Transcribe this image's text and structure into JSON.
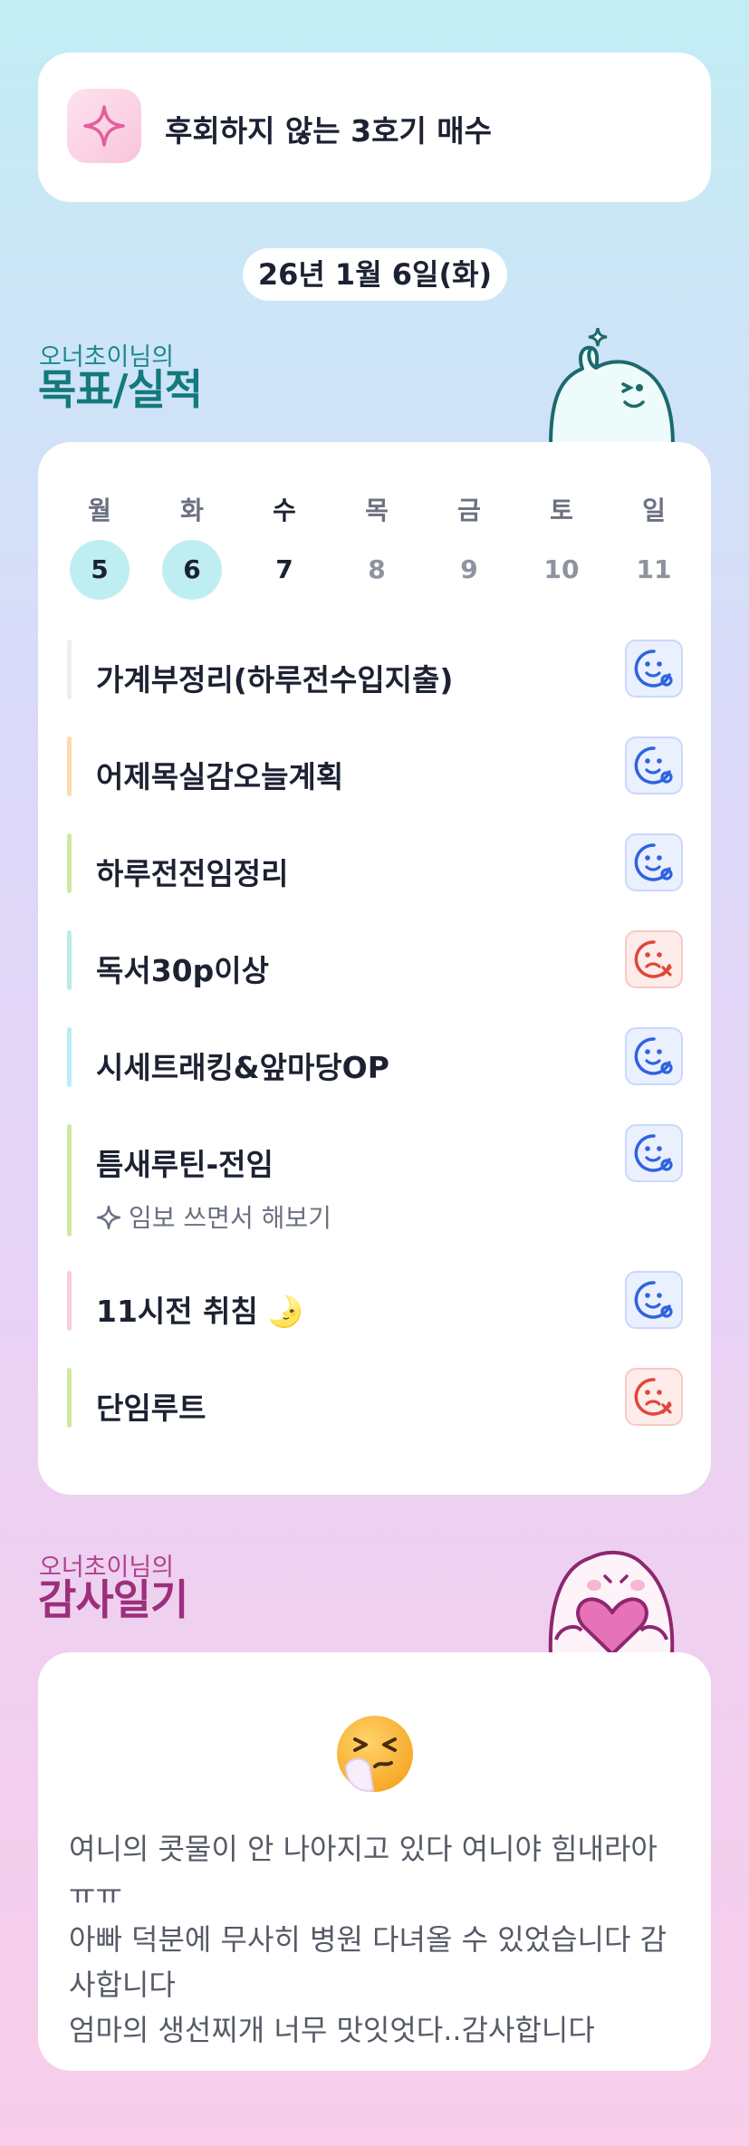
{
  "goal": {
    "text": "후회하지 않는 3호기 매수",
    "icon": "sparkle-icon"
  },
  "date": "26년 1월 6일(화)",
  "goals_section": {
    "subtitle": "오너초이님의",
    "title": "목표/실적"
  },
  "week": [
    {
      "label": "월",
      "num": "5",
      "state": "done"
    },
    {
      "label": "화",
      "num": "6",
      "state": "done"
    },
    {
      "label": "수",
      "num": "7",
      "state": "today"
    },
    {
      "label": "목",
      "num": "8",
      "state": "future"
    },
    {
      "label": "금",
      "num": "9",
      "state": "future"
    },
    {
      "label": "토",
      "num": "10",
      "state": "future"
    },
    {
      "label": "일",
      "num": "11",
      "state": "future"
    }
  ],
  "tasks": [
    {
      "name": "가계부정리(하루전수입지출)",
      "color": "#eeeeee",
      "status": "good"
    },
    {
      "name": "어제목실감오늘계획",
      "color": "#fcdcae",
      "status": "good"
    },
    {
      "name": "하루전전임정리",
      "color": "#cdeaa0",
      "status": "good"
    },
    {
      "name": "독서30p이상",
      "color": "#b8eee8",
      "status": "bad"
    },
    {
      "name": "시세트래킹&앞마당OP",
      "color": "#b8eef3",
      "status": "good"
    },
    {
      "name": "틈새루틴-전임",
      "note": "임보 쓰면서 해보기",
      "color": "#cdeaa0",
      "status": "good"
    },
    {
      "name": "11시전 취침",
      "emoji": "🌛",
      "color": "#f9cde0",
      "status": "good"
    },
    {
      "name": "단임루트",
      "color": "#cdeaa0",
      "status": "bad"
    }
  ],
  "thanks_section": {
    "subtitle": "오너초이님의",
    "title": "감사일기"
  },
  "thanks": {
    "emoji": "sneezing-face-icon",
    "lines": [
      "여니의 콧물이 안 나아지고 있다 여니야 힘내라아",
      "ㅠㅠ",
      "아빠 덕분에 무사히 병원 다녀올 수 있었습니다 감",
      "사합니다",
      "엄마의 생선찌개 너무 맛잇엇다..감사합니다"
    ]
  }
}
